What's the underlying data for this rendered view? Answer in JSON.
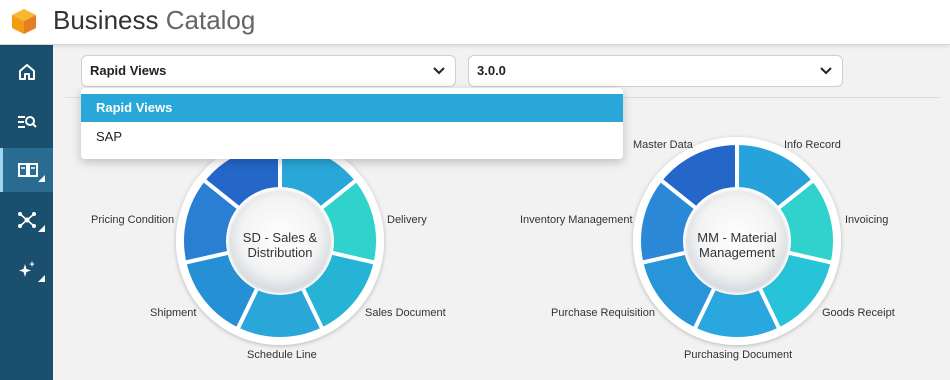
{
  "header": {
    "title_main": "Business",
    "title_sub": "Catalog",
    "logo_icon": "cube-logo-icon"
  },
  "sidebar": {
    "items": [
      {
        "icon": "home-icon"
      },
      {
        "icon": "search-list-icon"
      },
      {
        "icon": "book-icon",
        "active": true
      },
      {
        "icon": "network-icon"
      },
      {
        "icon": "sparkle-icon"
      }
    ]
  },
  "filters": {
    "view_select": {
      "value": "Rapid Views"
    },
    "version_select": {
      "value": "3.0.0"
    }
  },
  "dropdown": {
    "options": [
      {
        "label": "Rapid Views",
        "selected": true
      },
      {
        "label": "SAP",
        "selected": false
      }
    ]
  },
  "wheels": [
    {
      "center": "SD - Sales & Distribution",
      "center_line1": "SD - Sales &",
      "center_line2": "Distribution",
      "segments": [
        "Delivery",
        "Sales Document",
        "Schedule Line",
        "Shipment",
        "Pricing Condition"
      ]
    },
    {
      "center": "MM - Material Management",
      "center_line1": "MM - Material",
      "center_line2": "Management",
      "segments": [
        "Master Data",
        "Info Record",
        "Invoicing",
        "Goods Receipt",
        "Purchasing Document",
        "Purchase Requisition",
        "Inventory Management"
      ]
    }
  ],
  "colors": {
    "accent": "#29a7d9",
    "sidebar": "#1b4f6e",
    "sidebar_active": "#2a6b91",
    "segment_dark": "#2467c9",
    "segment_teal": "#2fd3cc"
  }
}
